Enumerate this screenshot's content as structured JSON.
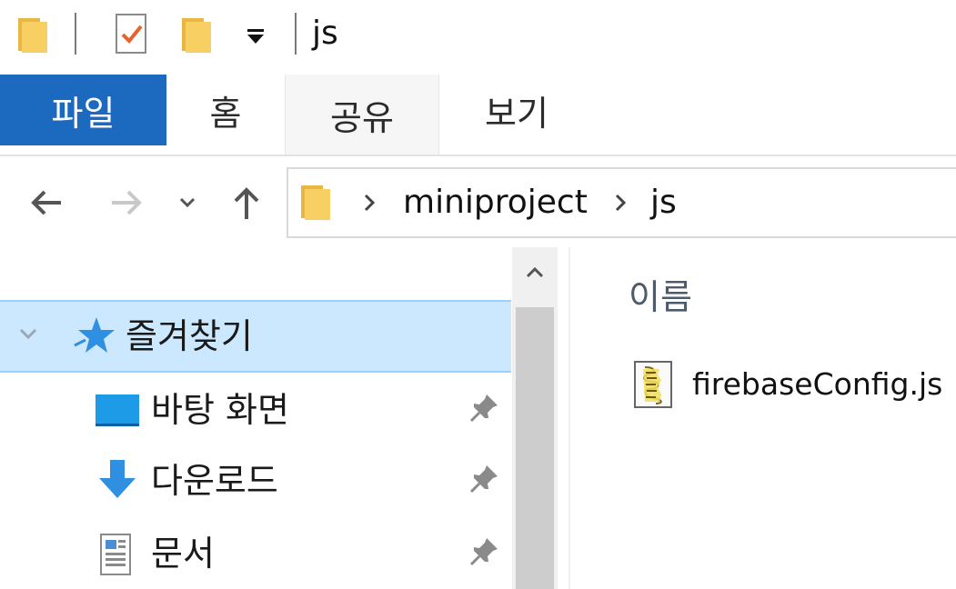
{
  "window": {
    "title": "js"
  },
  "quick_access_toolbar": {
    "items": [
      "folder-icon",
      "properties-check-icon",
      "new-folder-icon",
      "customize-dropdown-icon"
    ]
  },
  "ribbon": {
    "tabs": [
      {
        "label": "파일",
        "active": true
      },
      {
        "label": "홈"
      },
      {
        "label": "공유"
      },
      {
        "label": "보기"
      }
    ]
  },
  "navigation": {
    "back_icon": "arrow-left-icon",
    "forward_icon": "arrow-right-icon",
    "recent_icon": "chevron-down-icon",
    "up_icon": "arrow-up-icon"
  },
  "address_bar": {
    "crumbs": [
      "miniproject",
      "js"
    ]
  },
  "nav_pane": {
    "quick_access_label": "즐겨찾기",
    "items": [
      {
        "label": "바탕 화면",
        "icon": "desktop-icon",
        "pinned": true
      },
      {
        "label": "다운로드",
        "icon": "download-icon",
        "pinned": true
      },
      {
        "label": "문서",
        "icon": "documents-icon",
        "pinned": true
      }
    ]
  },
  "content": {
    "column_header": "이름",
    "files": [
      {
        "name": "firebaseConfig.js",
        "icon": "script-file-icon"
      }
    ]
  },
  "colors": {
    "file_tab_bg": "#1b6ac0",
    "selection_bg": "#cce8ff",
    "selection_border": "#99d1ff",
    "folder_yellow": "#f5c84c"
  }
}
